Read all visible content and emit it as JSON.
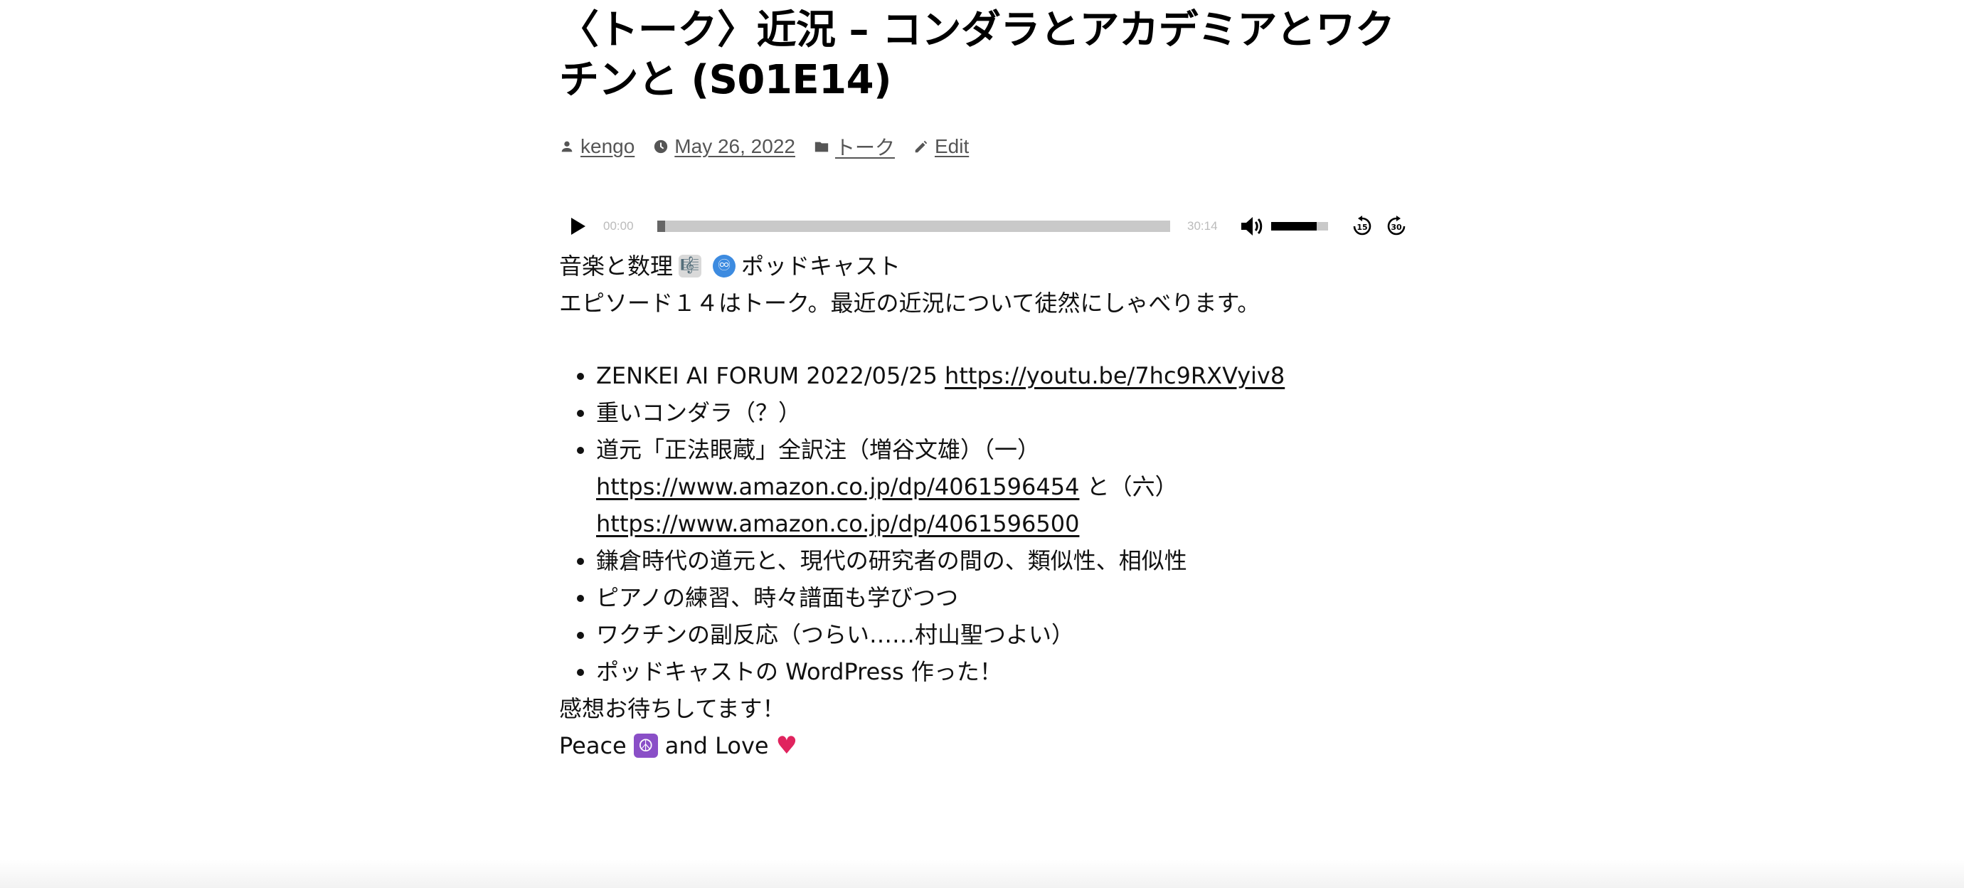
{
  "post": {
    "title": "〈トーク〉近況 – コンダラとアカデミアとワクチンと (S01E14)",
    "author": "kengo",
    "date": "May 26, 2022",
    "category": "トーク",
    "edit_label": "Edit"
  },
  "player": {
    "current_time": "00:00",
    "total_time": "30:14",
    "progress_fraction": 0.015,
    "volume_fraction": 0.8,
    "icons": {
      "play": "play-icon",
      "mute": "volume-icon",
      "back": "rewind-15-icon",
      "forward": "forward-30-icon"
    }
  },
  "content": {
    "intro_text_before": "音楽と数理",
    "intro_text_after": "ポッドキャスト",
    "intro_emoji_1": "🎼",
    "intro_emoji_2": "♾",
    "episode_text": "エピソード１４はトーク。最近の近況について徒然にしゃべります。",
    "topics": [
      {
        "text": "ZENKEI AI FORUM 2022/05/25 ",
        "link": "https://youtu.be/7hc9RXVyiv8"
      },
      {
        "text": "重いコンダラ（？）"
      },
      {
        "text": "道元「正法眼蔵」全訳注（増谷文雄）（一）",
        "link": "https://www.amazon.co.jp/dp/4061596454",
        "text2": " と（六）",
        "link2": "https://www.amazon.co.jp/dp/4061596500"
      },
      {
        "text": "鎌倉時代の道元と、現代の研究者の間の、類似性、相似性"
      },
      {
        "text": "ピアノの練習、時々譜面も学びつつ"
      },
      {
        "text": "ワクチンの副反応（つらい……村山聖つよい）"
      },
      {
        "text": "ポッドキャストの WordPress 作った！"
      }
    ],
    "thanks_text": "感想お待ちしてます！",
    "peace_before": "Peace",
    "peace_emoji": "☮",
    "peace_middle": "and Love",
    "heart_emoji": "♥"
  },
  "colors": {
    "meta_gray": "#555555",
    "progress_track": "#c9c9c9",
    "progress_fill": "#666666",
    "heart": "#e0245e",
    "peace_bg": "#8a4fc7",
    "infinity_bg": "#3d8be0"
  }
}
